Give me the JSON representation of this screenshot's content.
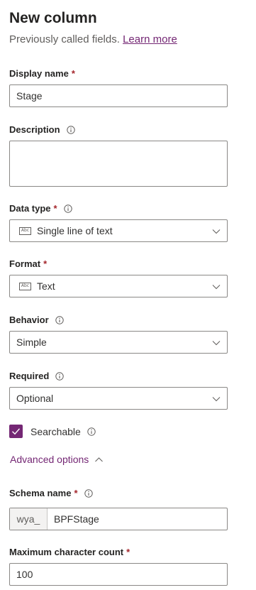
{
  "header": {
    "title": "New column",
    "subtitle": "Previously called fields.",
    "learn_more": "Learn more"
  },
  "required_marker": "*",
  "fields": {
    "display_name": {
      "label": "Display name",
      "value": "Stage"
    },
    "description": {
      "label": "Description",
      "value": ""
    },
    "data_type": {
      "label": "Data type",
      "value": "Single line of text",
      "icon": "abc-text-icon"
    },
    "format": {
      "label": "Format",
      "value": "Text",
      "icon": "abc-text-icon"
    },
    "behavior": {
      "label": "Behavior",
      "value": "Simple"
    },
    "required": {
      "label": "Required",
      "value": "Optional"
    },
    "searchable": {
      "label": "Searchable",
      "checked": true
    },
    "advanced_options": {
      "label": "Advanced options"
    },
    "schema_name": {
      "label": "Schema name",
      "prefix": "wya_",
      "value": "BPFStage"
    },
    "max_char_count": {
      "label": "Maximum character count",
      "value": "100"
    }
  },
  "icon_glyph": "Abc",
  "colors": {
    "accent": "#742774",
    "required": "#a4262c",
    "border": "#8a8886"
  }
}
